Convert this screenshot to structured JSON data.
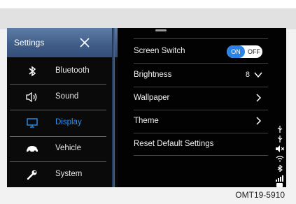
{
  "settings": {
    "title": "Settings",
    "items": [
      {
        "label": "Bluetooth",
        "icon": "bluetooth-icon"
      },
      {
        "label": "Sound",
        "icon": "speaker-icon"
      },
      {
        "label": "Display",
        "icon": "monitor-icon"
      },
      {
        "label": "Vehicle",
        "icon": "car-icon"
      },
      {
        "label": "System",
        "icon": "wrench-icon"
      }
    ]
  },
  "display": {
    "screen_switch": {
      "label": "Screen Switch",
      "on_label": "ON",
      "off_label": "OFF"
    },
    "brightness": {
      "label": "Brightness",
      "value": "8"
    },
    "wallpaper": {
      "label": "Wallpaper"
    },
    "theme": {
      "label": "Theme"
    },
    "reset": {
      "label": "Reset Default Settings"
    }
  },
  "figure_code": "OMT19-5910",
  "colors": {
    "accent": "#2b8ff0",
    "header": "#4a6a98",
    "screen": "#020202"
  }
}
